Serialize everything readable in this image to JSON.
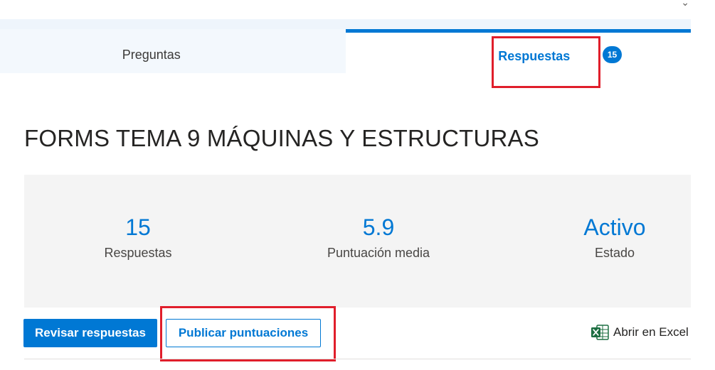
{
  "tabs": {
    "preguntas": "Preguntas",
    "respuestas": "Respuestas",
    "respuestas_count": "15"
  },
  "form": {
    "title": "FORMS TEMA 9 MÁQUINAS Y ESTRUCTURAS"
  },
  "stats": {
    "responses_value": "15",
    "responses_label": "Respuestas",
    "average_value": "5.9",
    "average_label": "Puntuación media",
    "status_value": "Activo",
    "status_label": "Estado"
  },
  "actions": {
    "review_label": "Revisar respuestas",
    "publish_label": "Publicar puntuaciones",
    "excel_label": "Abrir en Excel"
  },
  "colors": {
    "accent": "#0078d4",
    "highlight": "#e01e2b",
    "excel_green": "#1d6f42"
  },
  "icons": {
    "excel": "excel-icon"
  }
}
